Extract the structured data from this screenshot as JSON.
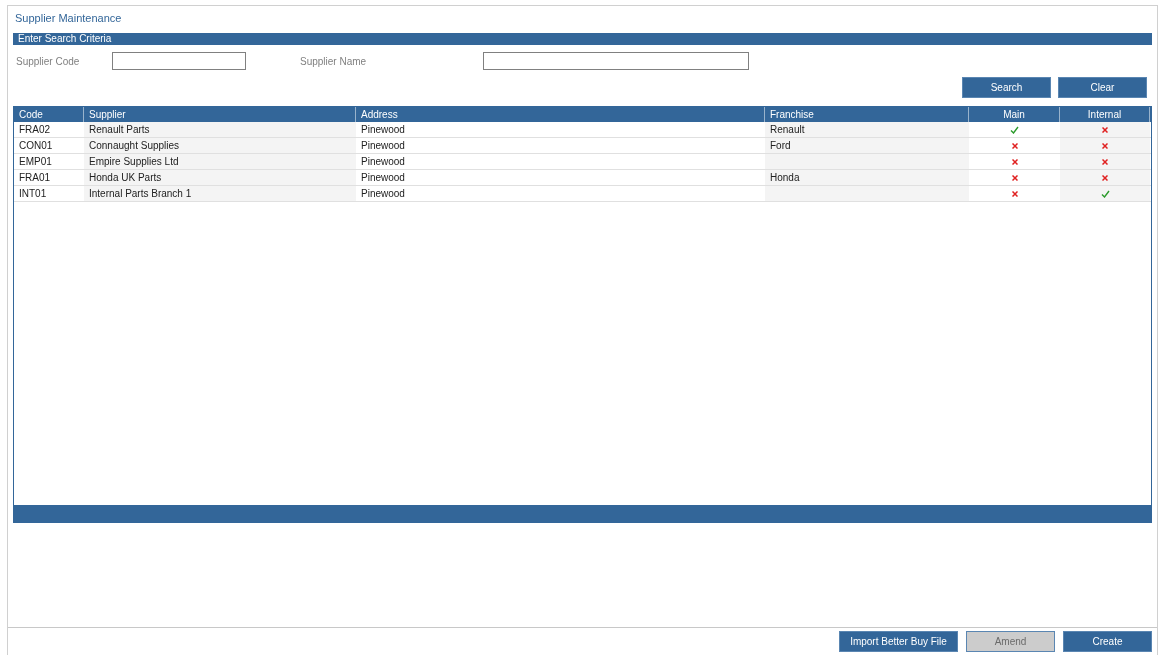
{
  "page_title": "Supplier Maintenance",
  "search_section": {
    "title": "Enter Search Criteria",
    "fields": [
      {
        "label": "Supplier Code"
      },
      {
        "label": "Supplier Name"
      }
    ],
    "buttons": [
      {
        "label": "Search",
        "disabled": false
      },
      {
        "label": "Clear",
        "disabled": false
      }
    ]
  },
  "table": {
    "columns": [
      "Code",
      "Supplier",
      "Address",
      "Franchise",
      "Main",
      "Internal"
    ],
    "rows": [
      {
        "code": "FRA02",
        "supplier": "Renault Parts",
        "address": "Pinewood",
        "franchise": "Renault",
        "main": true,
        "internal": false
      },
      {
        "code": "CON01",
        "supplier": "Connaught Supplies",
        "address": "Pinewood",
        "franchise": "Ford",
        "main": false,
        "internal": false
      },
      {
        "code": "EMP01",
        "supplier": "Empire Supplies Ltd",
        "address": "Pinewood",
        "franchise": "",
        "main": false,
        "internal": false
      },
      {
        "code": "FRA01",
        "supplier": "Honda UK Parts",
        "address": "Pinewood",
        "franchise": "Honda",
        "main": false,
        "internal": false
      },
      {
        "code": "INT01",
        "supplier": "Internal Parts Branch 1",
        "address": "Pinewood",
        "franchise": "",
        "main": false,
        "internal": true
      }
    ]
  },
  "footer_buttons": [
    {
      "label": "Import Better Buy File",
      "disabled": false
    },
    {
      "label": "Amend",
      "disabled": true
    },
    {
      "label": "Create",
      "disabled": false
    }
  ]
}
